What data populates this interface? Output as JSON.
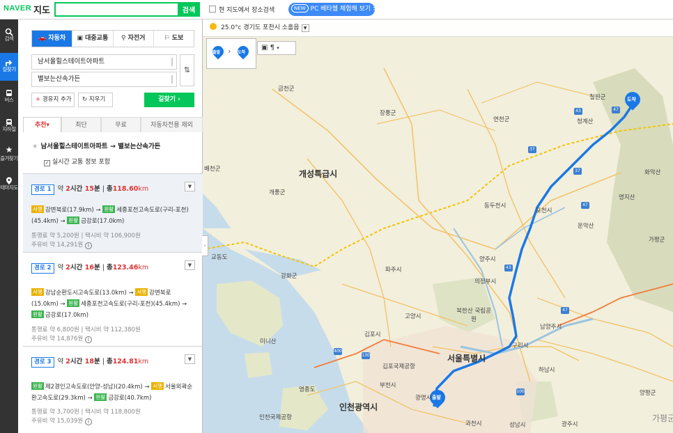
{
  "header": {
    "logo": "NAVER",
    "service": "지도",
    "search_placeholder": "",
    "search_button": "검색",
    "search_here_label": "현 지도에서 장소검색",
    "beta_new": "NEW",
    "beta_label": "PC 베타웹 체험해 보기 >"
  },
  "nav": [
    {
      "label": "검색",
      "icon": "search-icon"
    },
    {
      "label": "길찾기",
      "icon": "directions-icon"
    },
    {
      "label": "버스",
      "icon": "bus-icon"
    },
    {
      "label": "지하철",
      "icon": "subway-icon"
    },
    {
      "label": "즐겨찾기",
      "icon": "star-icon"
    },
    {
      "label": "테마지도",
      "icon": "pin-icon"
    }
  ],
  "modes": [
    "자동차",
    "대중교통",
    "자전거",
    "도보"
  ],
  "start": "남서울힐스테이트아파트",
  "end": "별보는산속가든",
  "buttons": {
    "waypoint": "경유지 추가",
    "clear": "지우기",
    "find": "길찾기 ›"
  },
  "filters": [
    "추천▾",
    "최단",
    "무료",
    "자동차전용 제외"
  ],
  "route_title": "남서울힐스테이트아파트 → 별보는산속가든",
  "realtime_label": "실시간 교통 정보 포함",
  "routes": [
    {
      "badge": "경로 1",
      "time_prefix": "약 ",
      "hours": "2",
      "hours_unit": "시간 ",
      "minutes": "15",
      "minutes_unit": "분",
      "dist_prefix": "총",
      "distance": "118.60",
      "dist_unit": "km",
      "segments": [
        {
          "tag": "서행",
          "tag_color": "y",
          "text": "강변북로(17.9km) → "
        },
        {
          "tag": "원활",
          "tag_color": "g",
          "text": "세종포천고속도로(구리-포천)(45.4km) → "
        },
        {
          "tag": "원활",
          "tag_color": "g",
          "text": "금강로(17.0km)"
        }
      ],
      "cost1": "통행료 약 5,200원 | 택시비 약 106,900원",
      "cost2": "주유비 약 14,291원"
    },
    {
      "badge": "경로 2",
      "time_prefix": "약 ",
      "hours": "2",
      "hours_unit": "시간 ",
      "minutes": "16",
      "minutes_unit": "분",
      "dist_prefix": "총",
      "distance": "123.46",
      "dist_unit": "km",
      "segments": [
        {
          "tag": "서행",
          "tag_color": "y",
          "text": "강남순환도시고속도로(13.0km) → "
        },
        {
          "tag": "서행",
          "tag_color": "y",
          "text": "강변북로(15.0km) → "
        },
        {
          "tag": "원활",
          "tag_color": "g",
          "text": "세종포천고속도로(구리-포천)(45.4km) → "
        },
        {
          "tag": "원활",
          "tag_color": "g",
          "text": "금강로(17.0km)"
        }
      ],
      "cost1": "통행료 약 6,800원 | 택시비 약 112,380원",
      "cost2": "주유비 약 14,876원"
    },
    {
      "badge": "경로 3",
      "time_prefix": "약 ",
      "hours": "2",
      "hours_unit": "시간 ",
      "minutes": "18",
      "minutes_unit": "분",
      "dist_prefix": "총",
      "distance": "124.81",
      "dist_unit": "km",
      "segments": [
        {
          "tag": "원활",
          "tag_color": "g",
          "text": "제2경인고속도로(안양-성남)(20.4km) → "
        },
        {
          "tag": "서행",
          "tag_color": "y",
          "text": "서울외곽순환고속도로(29.3km) → "
        },
        {
          "tag": "원활",
          "tag_color": "g",
          "text": "금강로(40.7km)"
        }
      ],
      "cost1": "통행료 약 3,700원 | 택시비 약 118,800원",
      "cost2": "주유비 약 15,039원"
    }
  ],
  "map": {
    "weather": "25.0°c 경기도 포천시 소흘읍",
    "start_pin": "출발",
    "end_pin": "도착",
    "labels": {
      "gimcheon": "금천군",
      "jangpung": "장풍군",
      "yeoncheon": "연천군",
      "cheorwon": "철원군",
      "kaesong": "개성특급시",
      "baecheon": "배천군",
      "gaepung": "개풍군",
      "dongducheon": "동두천시",
      "pocheon": "포천시",
      "paju": "파주시",
      "yangju": "양주시",
      "uijeongbu": "의정부시",
      "goyang": "고양시",
      "gimpo": "김포시",
      "seoul": "서울특별시",
      "incheon": "인천광역시",
      "gapyeong": "가평군",
      "namyangju": "남양주시",
      "guri": "구리시",
      "hanam": "하남시",
      "gwacheon": "과천시",
      "bucheon": "부천시",
      "gwangmyeong": "광명시",
      "ganghwa": "강화군",
      "gyodong": "교동도",
      "munido": "미니산",
      "yeongjong": "영종도",
      "gwangju": "광주시",
      "yangpyeong": "양평군",
      "hwaaksan": "화악산",
      "myeongjisan": "명지산",
      "unaksan": "운악산",
      "cheonggyesan": "청계산",
      "bukhansan": "북한산 국립공원",
      "gimpo_airport": "김포국제공항",
      "incheon_airport": "인천국제공항",
      "seongnam": "성남시",
      "gapyeong2": "가평군"
    }
  }
}
